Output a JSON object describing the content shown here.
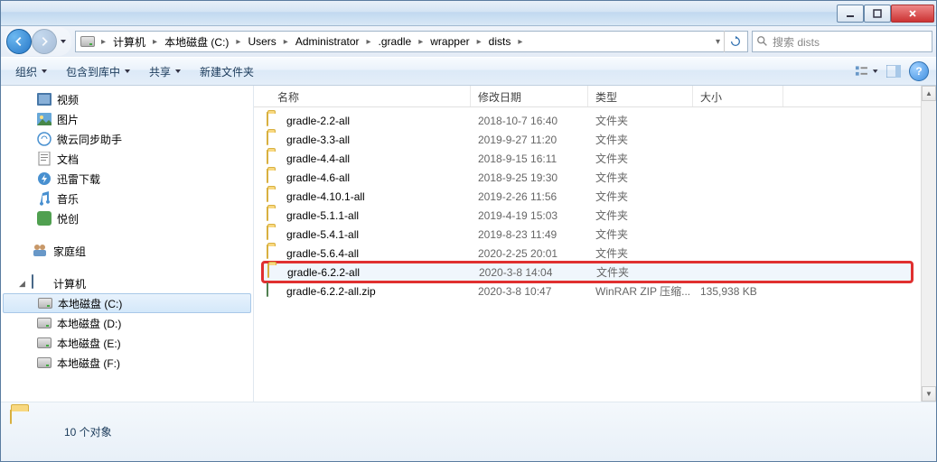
{
  "window": {
    "title": ""
  },
  "breadcrumb": {
    "segments": [
      "计算机",
      "本地磁盘 (C:)",
      "Users",
      "Administrator",
      ".gradle",
      "wrapper",
      "dists"
    ]
  },
  "search": {
    "placeholder": "搜索 dists"
  },
  "toolbar": {
    "organize": "组织",
    "include": "包含到库中",
    "share": "共享",
    "newfolder": "新建文件夹"
  },
  "sidebar": {
    "quick": [
      {
        "icon": "video",
        "label": "视频"
      },
      {
        "icon": "picture",
        "label": "图片"
      },
      {
        "icon": "sync",
        "label": "微云同步助手"
      },
      {
        "icon": "document",
        "label": "文档"
      },
      {
        "icon": "download",
        "label": "迅雷下载"
      },
      {
        "icon": "music",
        "label": "音乐"
      },
      {
        "icon": "app",
        "label": "悦创"
      }
    ],
    "homegroup": "家庭组",
    "computer": "计算机",
    "drives": [
      {
        "label": "本地磁盘 (C:)",
        "selected": true
      },
      {
        "label": "本地磁盘 (D:)"
      },
      {
        "label": "本地磁盘 (E:)"
      },
      {
        "label": "本地磁盘 (F:)"
      }
    ]
  },
  "columns": {
    "name": "名称",
    "date": "修改日期",
    "type": "类型",
    "size": "大小"
  },
  "files": [
    {
      "icon": "folder",
      "name": "gradle-2.2-all",
      "date": "2018-10-7 16:40",
      "type": "文件夹",
      "size": ""
    },
    {
      "icon": "folder",
      "name": "gradle-3.3-all",
      "date": "2019-9-27 11:20",
      "type": "文件夹",
      "size": ""
    },
    {
      "icon": "folder",
      "name": "gradle-4.4-all",
      "date": "2018-9-15 16:11",
      "type": "文件夹",
      "size": ""
    },
    {
      "icon": "folder",
      "name": "gradle-4.6-all",
      "date": "2018-9-25 19:30",
      "type": "文件夹",
      "size": ""
    },
    {
      "icon": "folder",
      "name": "gradle-4.10.1-all",
      "date": "2019-2-26 11:56",
      "type": "文件夹",
      "size": ""
    },
    {
      "icon": "folder",
      "name": "gradle-5.1.1-all",
      "date": "2019-4-19 15:03",
      "type": "文件夹",
      "size": ""
    },
    {
      "icon": "folder",
      "name": "gradle-5.4.1-all",
      "date": "2019-8-23 11:49",
      "type": "文件夹",
      "size": ""
    },
    {
      "icon": "folder",
      "name": "gradle-5.6.4-all",
      "date": "2020-2-25 20:01",
      "type": "文件夹",
      "size": ""
    },
    {
      "icon": "folder",
      "name": "gradle-6.2.2-all",
      "date": "2020-3-8 14:04",
      "type": "文件夹",
      "size": "",
      "highlighted": true,
      "selected": true
    },
    {
      "icon": "zip",
      "name": "gradle-6.2.2-all.zip",
      "date": "2020-3-8 10:47",
      "type": "WinRAR ZIP 压缩...",
      "size": "135,938 KB"
    }
  ],
  "status": {
    "count": "10 个对象"
  }
}
